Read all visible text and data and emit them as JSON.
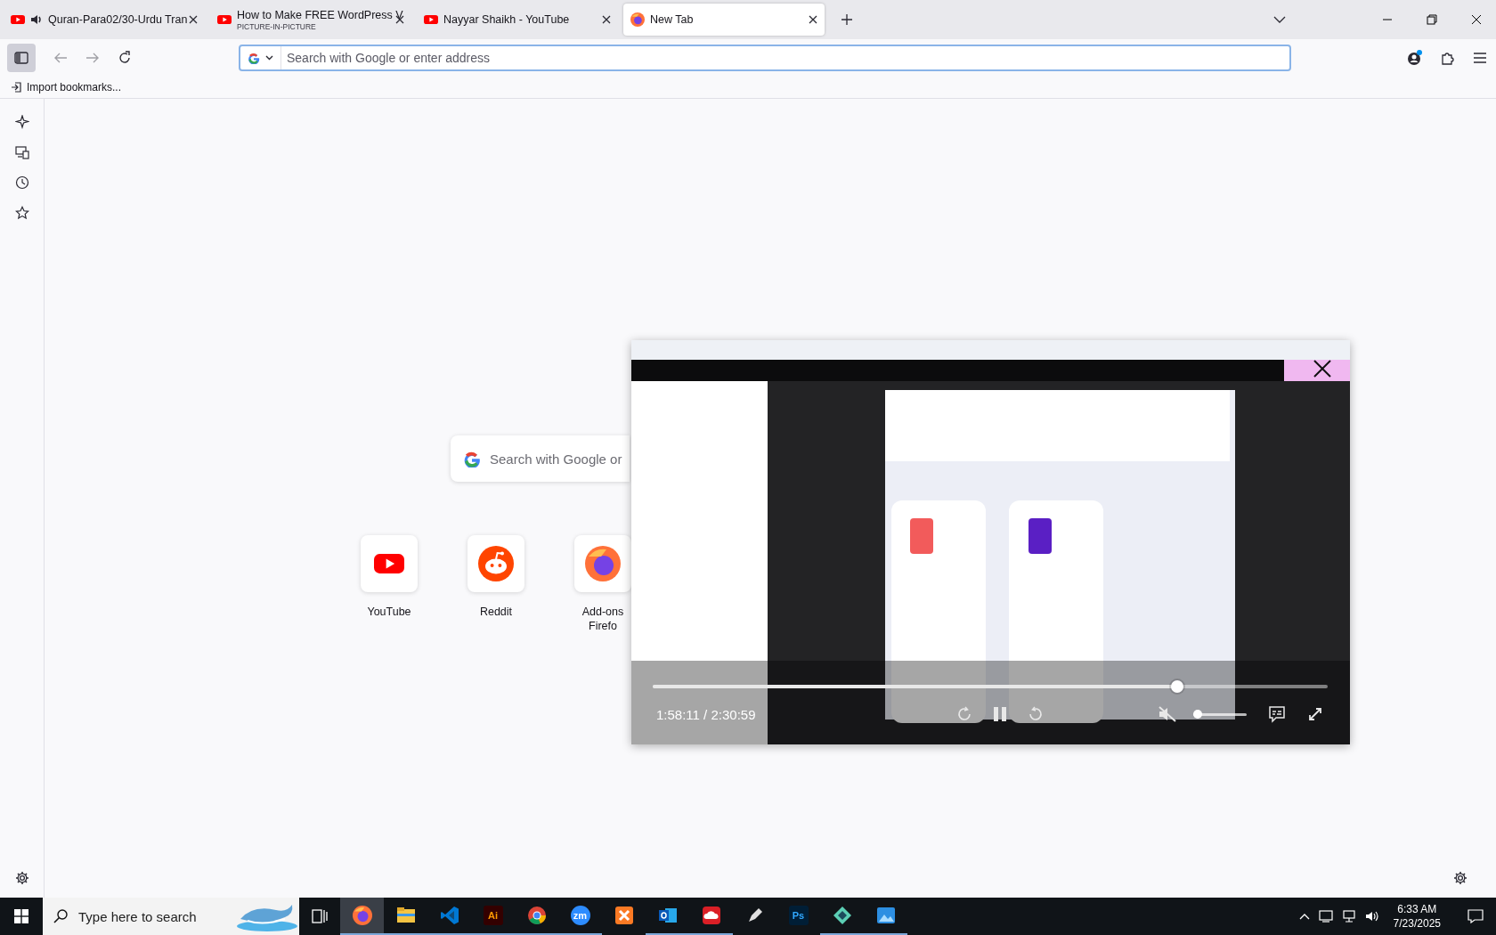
{
  "tabs": [
    {
      "title": "Quran-Para02/30-Urdu Tran",
      "kind": "youtube",
      "playing": true,
      "selected": false
    },
    {
      "title": "How to Make FREE WordPress V",
      "subtitle": "PICTURE-IN-PICTURE",
      "kind": "youtube",
      "playing": false,
      "selected": false
    },
    {
      "title": "Nayyar Shaikh - YouTube",
      "kind": "youtube",
      "playing": false,
      "selected": false
    },
    {
      "title": "New Tab",
      "kind": "firefox",
      "playing": false,
      "selected": true
    }
  ],
  "toolbar": {
    "address_placeholder": "Search with Google or enter address",
    "sidebar_open": true
  },
  "bookmarks": [
    {
      "label": "Import bookmarks..."
    }
  ],
  "new_tab": {
    "search_placeholder": "Search with Google or",
    "shortcuts": [
      {
        "kind": "youtube",
        "lines": [
          "YouTube"
        ]
      },
      {
        "kind": "reddit",
        "lines": [
          "Reddit"
        ]
      },
      {
        "kind": "firefox",
        "lines": [
          "Add-ons",
          "Firefo"
        ]
      }
    ]
  },
  "pip": {
    "time": "1:58:11 / 2:30:59",
    "level": 0.777,
    "muted": true,
    "volume": {
      "level": 0.0
    }
  },
  "taskbar": {
    "search_placeholder": "Type here to search",
    "apps": [
      {
        "kind": "firefox",
        "running": true,
        "selected": true
      },
      {
        "kind": "explorer",
        "running": true,
        "selected": false
      },
      {
        "kind": "vscode",
        "running": true,
        "selected": false
      },
      {
        "kind": "illustrator",
        "label": "Ai",
        "running": true,
        "selected": false
      },
      {
        "kind": "chrome",
        "running": true,
        "selected": false
      },
      {
        "kind": "zoom",
        "label": "zm",
        "running": true,
        "selected": false
      },
      {
        "kind": "xampp",
        "running": false,
        "selected": false
      },
      {
        "kind": "outlook",
        "running": true,
        "selected": false
      },
      {
        "kind": "creative",
        "running": true,
        "selected": false
      },
      {
        "kind": "pen",
        "running": false,
        "selected": false
      },
      {
        "kind": "photoshop",
        "label": "Ps",
        "running": false,
        "selected": false
      },
      {
        "kind": "diamond",
        "running": true,
        "selected": false
      },
      {
        "kind": "photos",
        "running": true,
        "selected": false
      }
    ],
    "time": "6:33 AM",
    "date": "7/23/2025"
  }
}
